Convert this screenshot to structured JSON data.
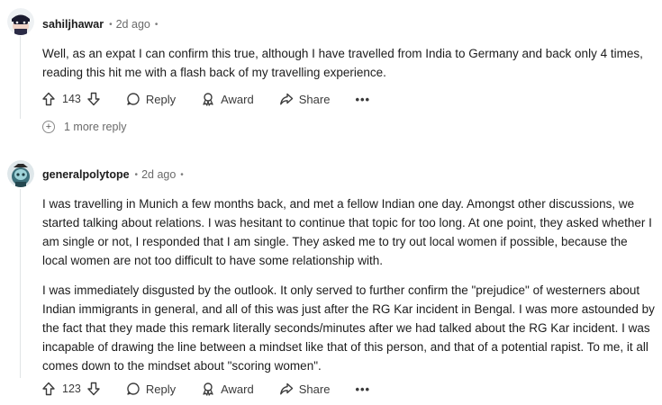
{
  "comments": [
    {
      "author": "sahiljhawar",
      "separator": "•",
      "time": "2d ago",
      "more_dot": "•",
      "paragraphs": [
        "Well, as an expat I can confirm this true, although I have travelled from India to Germany and back only 4 times, reading this hit me with a flash back of my travelling experience."
      ],
      "votes": "143",
      "reply_label": "Reply",
      "award_label": "Award",
      "share_label": "Share",
      "more_label": "•••",
      "more_replies_label": "1 more reply"
    },
    {
      "author": "generalpolytope",
      "separator": "•",
      "time": "2d ago",
      "more_dot": "•",
      "paragraphs": [
        "I was travelling in Munich a few months back, and met a fellow Indian one day. Amongst other discussions, we started talking about relations. I was hesitant to continue that topic for too long. At one point, they asked whether I am single or not, I responded that I am single. They asked me to try out local women if possible, because the local women are not too difficult to have some relationship with.",
        "I was immediately disgusted by the outlook. It only served to further confirm the \"prejudice\" of westerners about Indian immigrants in general, and all of this was just after the RG Kar incident in Bengal. I was more astounded by the fact that they made this remark literally seconds/minutes after we had talked about the RG Kar incident. I was incapable of drawing the line between a mindset like that of this person, and that of a potential rapist. To me, it all comes down to the mindset about \"scoring women\"."
      ],
      "votes": "123",
      "reply_label": "Reply",
      "award_label": "Award",
      "share_label": "Share",
      "more_label": "•••"
    }
  ],
  "colors": {
    "text": "#1c1c1c",
    "muted": "#6a6a6a",
    "thread": "#e1e4e6"
  }
}
